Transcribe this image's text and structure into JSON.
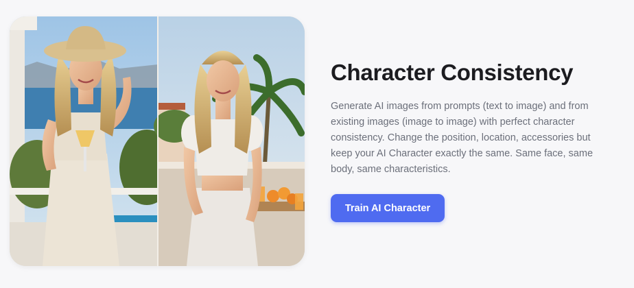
{
  "feature": {
    "title": "Character Consistency",
    "description": "Generate AI images from prompts (text to image) and from existing images (image to image) with perfect character consistency. Change the position, location, accessories but keep your AI Character exactly the same. Same face, same body, same characteristics.",
    "cta_label": "Train AI Character"
  },
  "images": [
    {
      "icon": "photo-woman-sunhat-with-drink"
    },
    {
      "icon": "photo-woman-white-top-balcony"
    }
  ],
  "colors": {
    "accent": "#4f6bf0",
    "heading": "#1c1c20",
    "body_text": "#6b6f7a",
    "background": "#f7f7f9"
  }
}
